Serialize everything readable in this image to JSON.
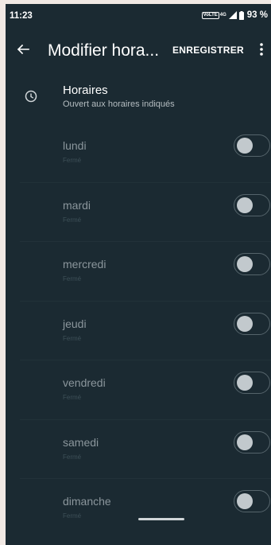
{
  "status_bar": {
    "time": "11:23",
    "volte_label": "VoLTE",
    "network_label": "4G",
    "battery_percent": "93 %",
    "icons": [
      "volte-icon",
      "signal-icon",
      "battery-icon"
    ]
  },
  "toolbar": {
    "title": "Modifier hora...",
    "save_label": "ENREGISTRER",
    "back_icon": "arrow-back-icon",
    "menu_icon": "more-vert-icon"
  },
  "section": {
    "title": "Horaires",
    "subtitle": "Ouvert aux horaires indiqués",
    "icon": "clock-icon"
  },
  "days": [
    {
      "name": "lundi",
      "status": "Fermé",
      "enabled": false
    },
    {
      "name": "mardi",
      "status": "Fermé",
      "enabled": false
    },
    {
      "name": "mercredi",
      "status": "Fermé",
      "enabled": false
    },
    {
      "name": "jeudi",
      "status": "Fermé",
      "enabled": false
    },
    {
      "name": "vendredi",
      "status": "Fermé",
      "enabled": false
    },
    {
      "name": "samedi",
      "status": "Fermé",
      "enabled": false
    },
    {
      "name": "dimanche",
      "status": "Fermé",
      "enabled": false
    }
  ],
  "colors": {
    "background": "#1b2a32",
    "text_primary": "#ffffff",
    "text_day": "#8b969c",
    "text_status": "#3e5058",
    "toggle_thumb": "#c2c9cd"
  }
}
